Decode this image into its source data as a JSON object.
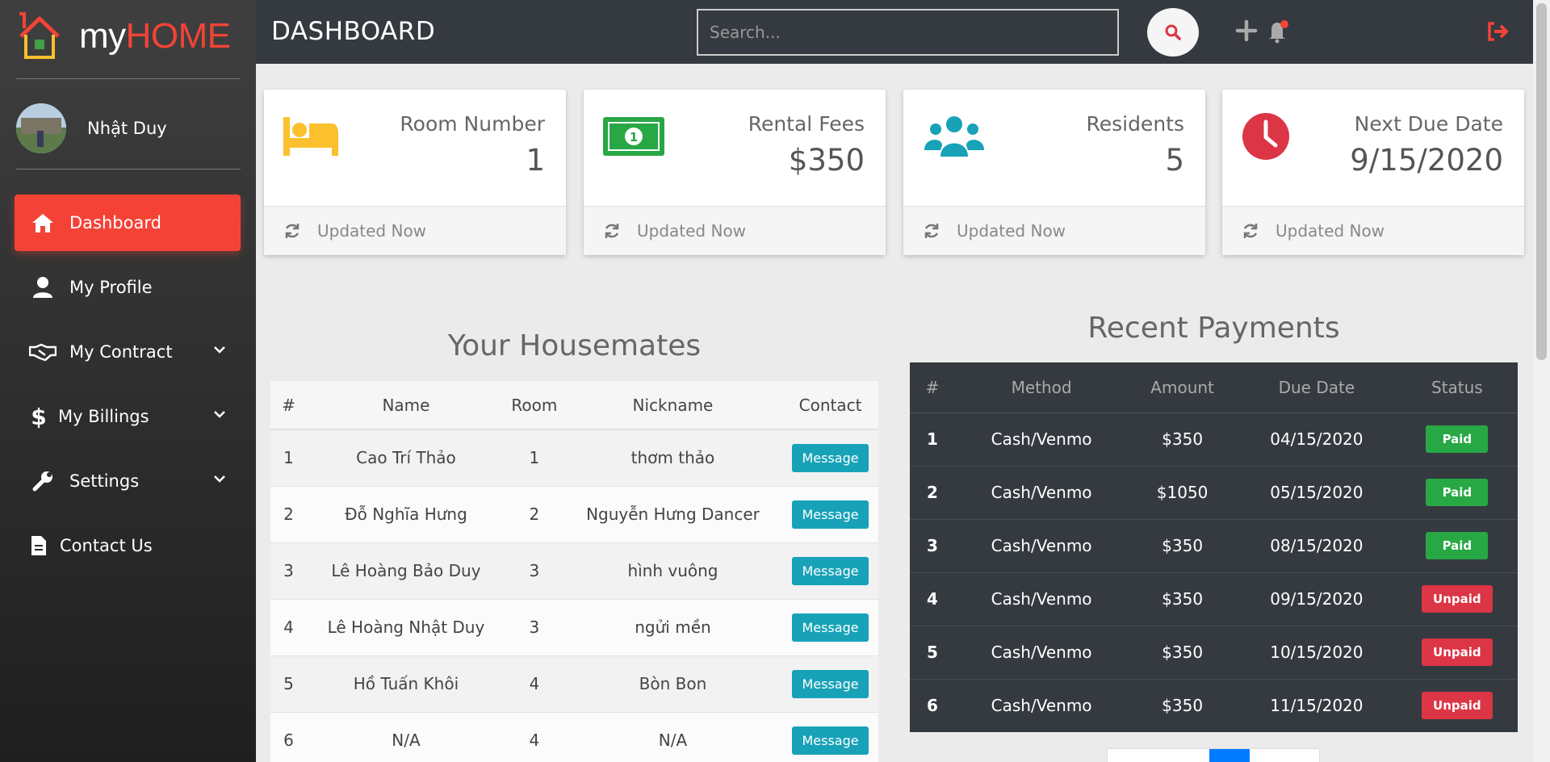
{
  "brand": {
    "my": "my",
    "home": "HOME"
  },
  "user": {
    "name": "Nhật Duy"
  },
  "sidebar": {
    "items": [
      {
        "label": "Dashboard",
        "icon": "home-icon",
        "active": true
      },
      {
        "label": "My Profile",
        "icon": "user-icon"
      },
      {
        "label": "My Contract",
        "icon": "handshake-icon",
        "dropdown": true
      },
      {
        "label": "My Billings",
        "icon": "dollar-icon",
        "dropdown": true
      },
      {
        "label": "Settings",
        "icon": "wrench-icon",
        "dropdown": true
      },
      {
        "label": "Contact Us",
        "icon": "file-icon"
      }
    ]
  },
  "header": {
    "title": "DASHBOARD",
    "search_placeholder": "Search..."
  },
  "cards": [
    {
      "label": "Room Number",
      "value": "1",
      "footer": "Updated Now",
      "icon": "bed-icon",
      "color": "#fbc02d"
    },
    {
      "label": "Rental Fees",
      "value": "$350",
      "footer": "Updated Now",
      "icon": "money-icon",
      "color": "#28a745"
    },
    {
      "label": "Residents",
      "value": "5",
      "footer": "Updated Now",
      "icon": "users-icon",
      "color": "#17a2b8"
    },
    {
      "label": "Next Due Date",
      "value": "9/15/2020",
      "footer": "Updated Now",
      "icon": "clock-icon",
      "color": "#dc3545"
    }
  ],
  "housemates": {
    "title": "Your Housemates",
    "columns": [
      "#",
      "Name",
      "Room",
      "Nickname",
      "Contact"
    ],
    "rows": [
      {
        "num": "1",
        "name": "Cao Trí Thảo",
        "room": "1",
        "nickname": "thơm thảo",
        "action": "Message"
      },
      {
        "num": "2",
        "name": "Đỗ Nghĩa Hưng",
        "room": "2",
        "nickname": "Nguyễn Hưng Dancer",
        "action": "Message"
      },
      {
        "num": "3",
        "name": "Lê Hoàng Bảo Duy",
        "room": "3",
        "nickname": "hình vuông",
        "action": "Message"
      },
      {
        "num": "4",
        "name": "Lê Hoàng Nhật Duy",
        "room": "3",
        "nickname": "ngửi mền",
        "action": "Message"
      },
      {
        "num": "5",
        "name": "Hồ Tuấn Khôi",
        "room": "4",
        "nickname": "Bòn Bon",
        "action": "Message"
      },
      {
        "num": "6",
        "name": "N/A",
        "room": "4",
        "nickname": "N/A",
        "action": "Message"
      }
    ]
  },
  "payments": {
    "title": "Recent Payments",
    "columns": [
      "#",
      "Method",
      "Amount",
      "Due Date",
      "Status"
    ],
    "rows": [
      {
        "num": "1",
        "method": "Cash/Venmo",
        "amount": "$350",
        "due": "04/15/2020",
        "status": "Paid"
      },
      {
        "num": "2",
        "method": "Cash/Venmo",
        "amount": "$1050",
        "due": "05/15/2020",
        "status": "Paid"
      },
      {
        "num": "3",
        "method": "Cash/Venmo",
        "amount": "$350",
        "due": "08/15/2020",
        "status": "Paid"
      },
      {
        "num": "4",
        "method": "Cash/Venmo",
        "amount": "$350",
        "due": "09/15/2020",
        "status": "Unpaid"
      },
      {
        "num": "5",
        "method": "Cash/Venmo",
        "amount": "$350",
        "due": "10/15/2020",
        "status": "Unpaid"
      },
      {
        "num": "6",
        "method": "Cash/Venmo",
        "amount": "$350",
        "due": "11/15/2020",
        "status": "Unpaid"
      }
    ]
  },
  "colors": {
    "accent": "#f44336",
    "topbar": "#343a40",
    "info": "#17a2b8",
    "success": "#28a745",
    "danger": "#dc3545"
  }
}
